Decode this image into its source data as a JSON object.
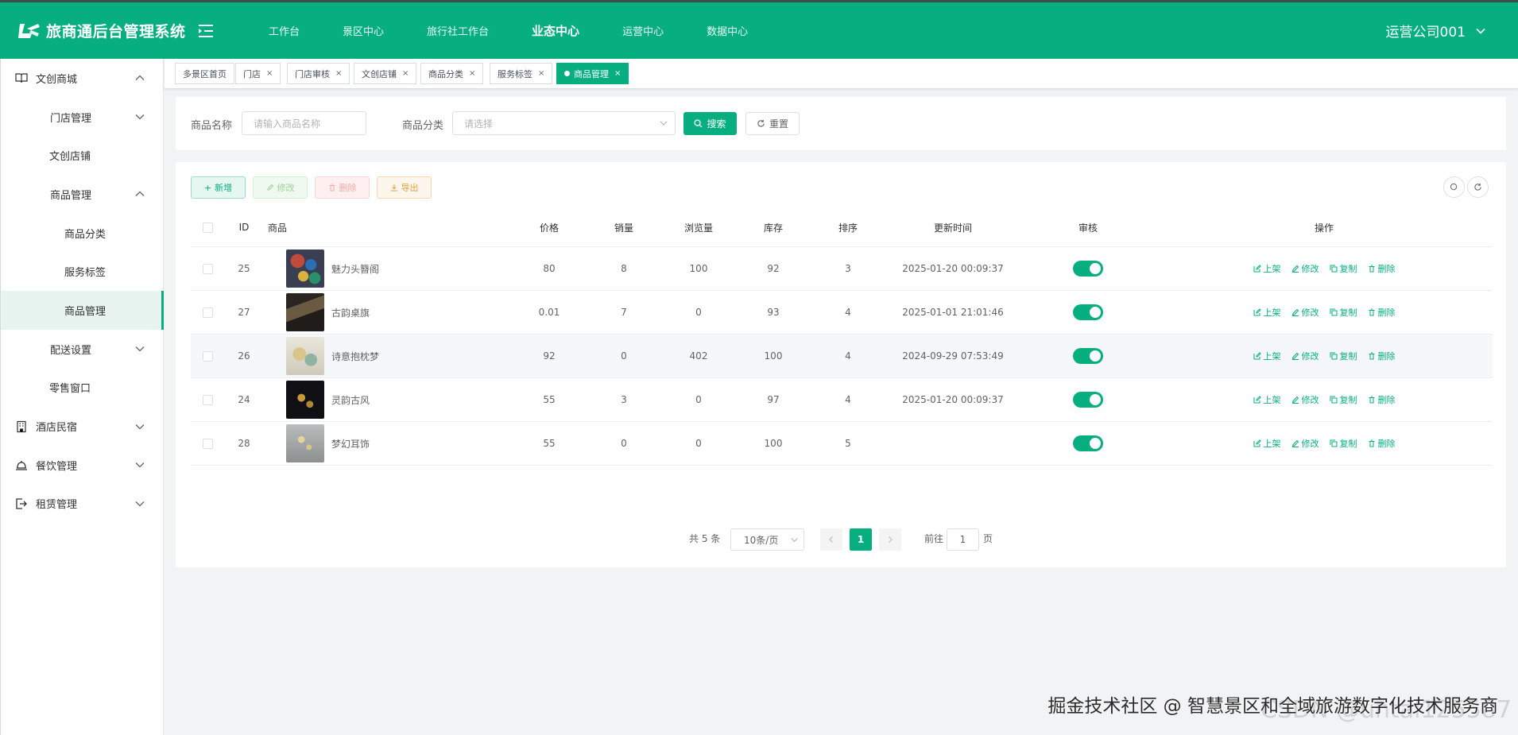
{
  "app": {
    "title": "旅商通后台管理系统",
    "user": "运营公司001",
    "accent": "#07ae80"
  },
  "top_nav": [
    {
      "label": "工作台"
    },
    {
      "label": "景区中心"
    },
    {
      "label": "旅行社工作台"
    },
    {
      "label": "业态中心",
      "active": true
    },
    {
      "label": "运营中心"
    },
    {
      "label": "数据中心"
    }
  ],
  "sidebar": {
    "items": [
      {
        "label": "文创商城",
        "icon": "book-icon",
        "expanded": true
      },
      {
        "label": "门店管理"
      },
      {
        "label": "文创店铺"
      },
      {
        "label": "商品管理"
      },
      {
        "label": "商品分类"
      },
      {
        "label": "服务标签"
      },
      {
        "label": "商品管理",
        "active": true
      },
      {
        "label": "配送设置"
      },
      {
        "label": "零售窗口"
      },
      {
        "label": "酒店民宿",
        "icon": "building-icon"
      },
      {
        "label": "餐饮管理",
        "icon": "bell-icon"
      },
      {
        "label": "租赁管理",
        "icon": "exit-icon"
      }
    ]
  },
  "tags": [
    {
      "label": "多景区首页"
    },
    {
      "label": "门店"
    },
    {
      "label": "门店审核"
    },
    {
      "label": "文创店铺"
    },
    {
      "label": "商品分类"
    },
    {
      "label": "服务标签"
    },
    {
      "label": "商品管理",
      "active": true
    }
  ],
  "search": {
    "name_label": "商品名称",
    "name_placeholder": "请输入商品名称",
    "category_label": "商品分类",
    "category_placeholder": "请选择",
    "search_label": "搜索",
    "reset_label": "重置"
  },
  "toolbar": {
    "add_label": "新增",
    "edit_label": "修改",
    "delete_label": "删除",
    "export_label": "导出"
  },
  "table": {
    "headers": {
      "id": "ID",
      "product": "商品",
      "price": "价格",
      "sales": "销量",
      "views": "浏览量",
      "stock": "库存",
      "sort": "排序",
      "updated": "更新时间",
      "audit": "审核",
      "actions": "操作"
    },
    "rows": [
      {
        "id": "25",
        "name": "魅力头簪阁",
        "price": "80",
        "sales": "8",
        "views": "100",
        "stock": "92",
        "sort": "3",
        "updated": "2025-01-20 00:09:37",
        "audit": true
      },
      {
        "id": "27",
        "name": "古韵桌旗",
        "price": "0.01",
        "sales": "7",
        "views": "0",
        "stock": "93",
        "sort": "4",
        "updated": "2025-01-01 21:01:46",
        "audit": true
      },
      {
        "id": "26",
        "name": "诗意抱枕梦",
        "price": "92",
        "sales": "0",
        "views": "402",
        "stock": "100",
        "sort": "4",
        "updated": "2024-09-29 07:53:49",
        "audit": true
      },
      {
        "id": "24",
        "name": "灵韵古风",
        "price": "55",
        "sales": "3",
        "views": "0",
        "stock": "97",
        "sort": "4",
        "updated": "2025-01-20 00:09:37",
        "audit": true
      },
      {
        "id": "28",
        "name": "梦幻耳饰",
        "price": "55",
        "sales": "0",
        "views": "0",
        "stock": "100",
        "sort": "5",
        "updated": "",
        "audit": true
      }
    ],
    "row_actions": {
      "shelve": "上架",
      "edit": "修改",
      "copy": "复制",
      "delete": "删除"
    }
  },
  "pagination": {
    "total": "共 5 条",
    "page_size": "10条/页",
    "current_page": "1",
    "goto_label": "前往",
    "goto_value": "1",
    "page_suffix": "页"
  },
  "watermark": {
    "text": "掘金技术社区 @ 智慧景区和全域旅游数字化技术服务商",
    "ghost": "CSDN @untal125587"
  }
}
